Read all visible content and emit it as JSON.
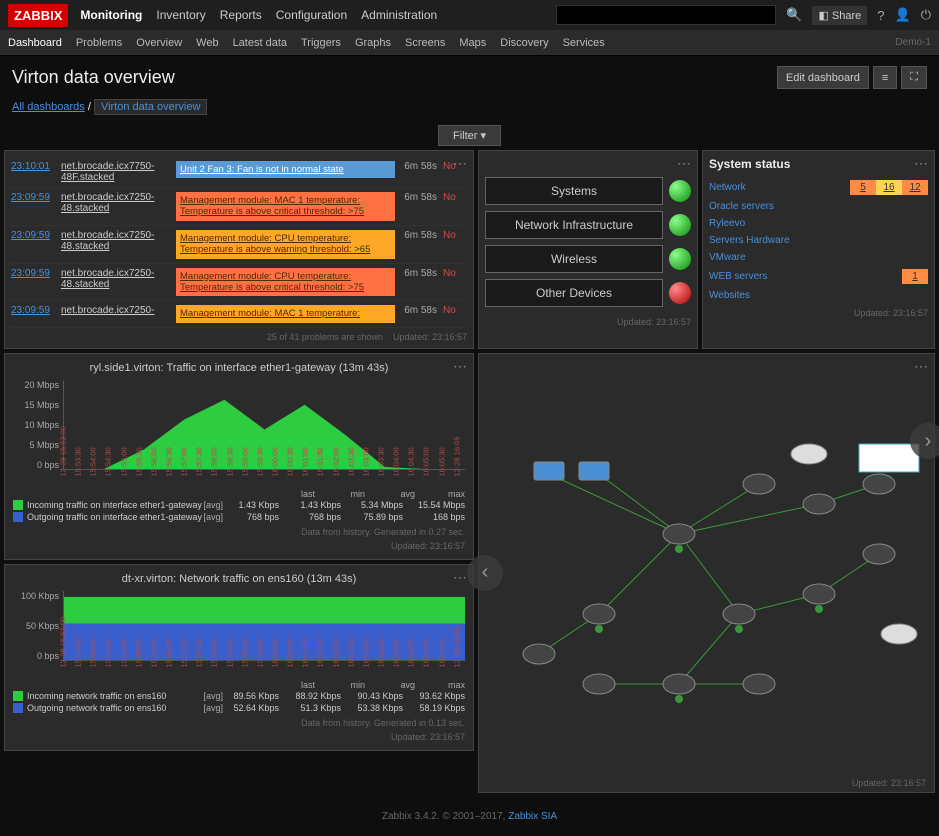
{
  "brand": "ZABBIX",
  "topnav": [
    "Monitoring",
    "Inventory",
    "Reports",
    "Configuration",
    "Administration"
  ],
  "topnav_active": "Monitoring",
  "share_label": "Share",
  "subnav": [
    "Dashboard",
    "Problems",
    "Overview",
    "Web",
    "Latest data",
    "Triggers",
    "Graphs",
    "Screens",
    "Maps",
    "Discovery",
    "Services"
  ],
  "subnav_active": "Dashboard",
  "host_id": "Demo-1",
  "page_title": "Virton data overview",
  "edit_btn": "Edit dashboard",
  "breadcrumb": {
    "root": "All dashboards",
    "current": "Virton data overview"
  },
  "filter_label": "Filter ▾",
  "problems": [
    {
      "time": "23:10:01",
      "host": "net.brocade.icx7750-48F.stacked",
      "desc": "Unit 2 Fan 3: Fan is not in normal state",
      "sev": "info",
      "dur": "6m 58s",
      "ack": "No"
    },
    {
      "time": "23:09:59",
      "host": "net.brocade.icx7250-48.stacked",
      "desc": "Management module: MAC 1 temperature: Temperature is above critical threshold: >75",
      "sev": "average",
      "dur": "6m 58s",
      "ack": "No"
    },
    {
      "time": "23:09:59",
      "host": "net.brocade.icx7250-48.stacked",
      "desc": "Management module: CPU temperature: Temperature is above warning threshold: >65",
      "sev": "warning",
      "dur": "6m 58s",
      "ack": "No"
    },
    {
      "time": "23:09:59",
      "host": "net.brocade.icx7250-48.stacked",
      "desc": "Management module: CPU temperature: Temperature is above critical threshold: >75",
      "sev": "average",
      "dur": "6m 58s",
      "ack": "No"
    },
    {
      "time": "23:09:59",
      "host": "net.brocade.icx7250-",
      "desc": "Management module: MAC 1 temperature:",
      "sev": "warning",
      "dur": "6m 58s",
      "ack": "No"
    }
  ],
  "problems_footer": "25 of 41 problems are shown",
  "updated": "Updated: 23:16:57",
  "status_buttons": [
    {
      "label": "Systems",
      "led": "green"
    },
    {
      "label": "Network Infrastructure",
      "led": "green"
    },
    {
      "label": "Wireless",
      "led": "green"
    },
    {
      "label": "Other Devices",
      "led": "red"
    }
  ],
  "system_status": {
    "title": "System status",
    "rows": [
      {
        "name": "Network",
        "cells": [
          {
            "v": "5",
            "c": "orange"
          },
          {
            "v": "16",
            "c": "yellow"
          },
          {
            "v": "12",
            "c": "orange"
          }
        ]
      },
      {
        "name": "Oracle servers",
        "cells": []
      },
      {
        "name": "Ryleevo",
        "cells": []
      },
      {
        "name": "Servers Hardware",
        "cells": []
      },
      {
        "name": "VMware",
        "cells": []
      },
      {
        "name": "WEB servers",
        "cells": [
          {
            "v": "1",
            "c": "orange"
          }
        ]
      },
      {
        "name": "Websites",
        "cells": []
      }
    ]
  },
  "chart1": {
    "title": "ryl.side1.virton: Traffic on interface ether1-gateway (13m 43s)",
    "yticks": [
      "20 Mbps",
      "15 Mbps",
      "10 Mbps",
      "5 Mbps",
      "0 bps"
    ],
    "xticks": [
      "12-28 15:53:00",
      "15:53:30",
      "15:54:00",
      "15:54:30",
      "15:55:00",
      "15:55:30",
      "15:56:00",
      "15:56:30",
      "15:57:00",
      "15:57:30",
      "15:58:00",
      "15:58:30",
      "15:59:00",
      "15:59:30",
      "16:00:00",
      "16:00:30",
      "16:01:00",
      "16:01:30",
      "16:02:00",
      "16:02:30",
      "16:03:00",
      "16:03:30",
      "16:04:00",
      "16:04:30",
      "16:05:00",
      "16:05:30",
      "12-28 16:05"
    ],
    "cols": [
      "last",
      "min",
      "avg",
      "max"
    ],
    "series": [
      {
        "color": "#2ecc40",
        "label": "Incoming traffic on interface ether1-gateway",
        "vals": [
          "1.43 Kbps",
          "1.43 Kbps",
          "5.34 Mbps",
          "15.54 Mbps"
        ]
      },
      {
        "color": "#3a5fcd",
        "label": "Outgoing traffic on interface ether1-gateway",
        "vals": [
          "768 bps",
          "768 bps",
          "75.89 bps",
          "168 bps"
        ]
      }
    ],
    "note": "Data from history. Generated in 0.27 sec."
  },
  "chart2": {
    "title": "dt-xr.virton: Network traffic on ens160 (13m 43s)",
    "yticks": [
      "100 Kbps",
      "50 Kbps",
      "0 bps"
    ],
    "xticks": [
      "12-28 15:53:00",
      "15:53:30",
      "15:54:00",
      "15:54:30",
      "15:55:00",
      "15:55:30",
      "15:56:00",
      "15:56:30",
      "15:57:00",
      "15:57:30",
      "15:58:00",
      "15:58:30",
      "15:59:00",
      "15:59:30",
      "16:00:00",
      "16:00:30",
      "16:01:00",
      "16:01:30",
      "16:02:00",
      "16:02:30",
      "16:03:00",
      "16:03:30",
      "16:04:00",
      "16:04:30",
      "16:05:00",
      "16:05:30",
      "12-28 16:05"
    ],
    "cols": [
      "last",
      "min",
      "avg",
      "max"
    ],
    "series": [
      {
        "color": "#2ecc40",
        "label": "Incoming network traffic on ens160",
        "vals": [
          "89.56 Kbps",
          "88.92 Kbps",
          "90.43 Kbps",
          "93.62 Kbps"
        ]
      },
      {
        "color": "#3a5fcd",
        "label": "Outgoing network traffic on ens160",
        "vals": [
          "52.64 Kbps",
          "51.3 Kbps",
          "53.38 Kbps",
          "58.19 Kbps"
        ]
      }
    ],
    "note": "Data from history. Generated in 0.13 sec."
  },
  "chart_data": [
    {
      "type": "area",
      "title": "ryl.side1.virton: Traffic on interface ether1-gateway (13m 43s)",
      "x": [
        "15:53",
        "15:55",
        "15:57",
        "15:59",
        "16:01",
        "16:03",
        "16:05"
      ],
      "series": [
        {
          "name": "Incoming",
          "values": [
            0,
            5,
            12,
            15,
            9,
            14,
            6,
            0
          ]
        },
        {
          "name": "Outgoing",
          "values": [
            0,
            0,
            0,
            0,
            0,
            0,
            0,
            0
          ]
        }
      ],
      "ylabel": "bps",
      "ylim": [
        0,
        20
      ]
    },
    {
      "type": "area",
      "title": "dt-xr.virton: Network traffic on ens160 (13m 43s)",
      "x": [
        "15:53",
        "15:55",
        "15:57",
        "15:59",
        "16:01",
        "16:03",
        "16:05"
      ],
      "series": [
        {
          "name": "Incoming",
          "values": [
            90,
            90,
            90,
            90,
            90,
            90,
            90
          ]
        },
        {
          "name": "Outgoing",
          "values": [
            52,
            52,
            52,
            52,
            52,
            52,
            52
          ]
        }
      ],
      "ylabel": "Kbps",
      "ylim": [
        0,
        100
      ]
    }
  ],
  "footer": {
    "text": "Zabbix 3.4.2. © 2001–2017, ",
    "link": "Zabbix SIA"
  }
}
